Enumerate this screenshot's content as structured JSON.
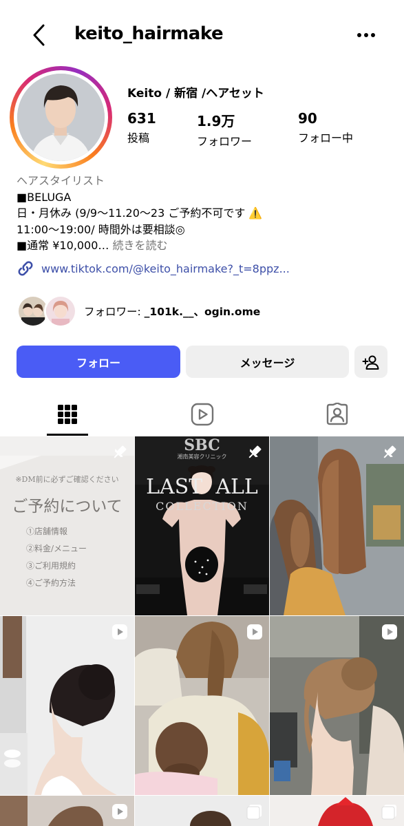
{
  "header": {
    "username": "keito_hairmake"
  },
  "profile": {
    "display_name": "Keito / 新宿 /ヘアセット",
    "stats": [
      {
        "value": "631",
        "label": "投稿"
      },
      {
        "value": "1.9万",
        "label": "フォロワー"
      },
      {
        "value": "90",
        "label": "フォロー中"
      }
    ],
    "category": "ヘアスタイリスト",
    "bio_lines": [
      "■BELUGA",
      "日・月休み (9/9～11.20～23 ご予約不可です ⚠️",
      "11:00～19:00/ 時間外は要相談◎",
      "■通常 ¥10,000…"
    ],
    "bio_more": "続きを読む",
    "link": "www.tiktok.com/@keito_hairmake?_t=8ppz...",
    "followed_by_prefix": "フォロワー: ",
    "followed_by_names": "_101k.__、ogin.ome"
  },
  "actions": {
    "follow_label": "フォロー",
    "message_label": "メッセージ"
  },
  "tabs": [
    "grid-tab",
    "reels-tab",
    "tagged-tab"
  ],
  "posts": {
    "first": {
      "notice": "※DM前に必ずご確認ください",
      "heading": "ご予約について",
      "items": [
        "①店舗情報",
        "②料金/メニュー",
        "③ご利用規約",
        "④ご予約方法"
      ]
    },
    "second": {
      "sign_top": "SBC",
      "sign_sub": "湘南美容クリニック",
      "headline": "LAST  ALL",
      "subline": "COLLECTION"
    }
  },
  "colors": {
    "accent_blue": "#4a5cf5",
    "link_blue": "#3d4fa8",
    "secondary_text": "#737373",
    "button_gray": "#efefef"
  }
}
